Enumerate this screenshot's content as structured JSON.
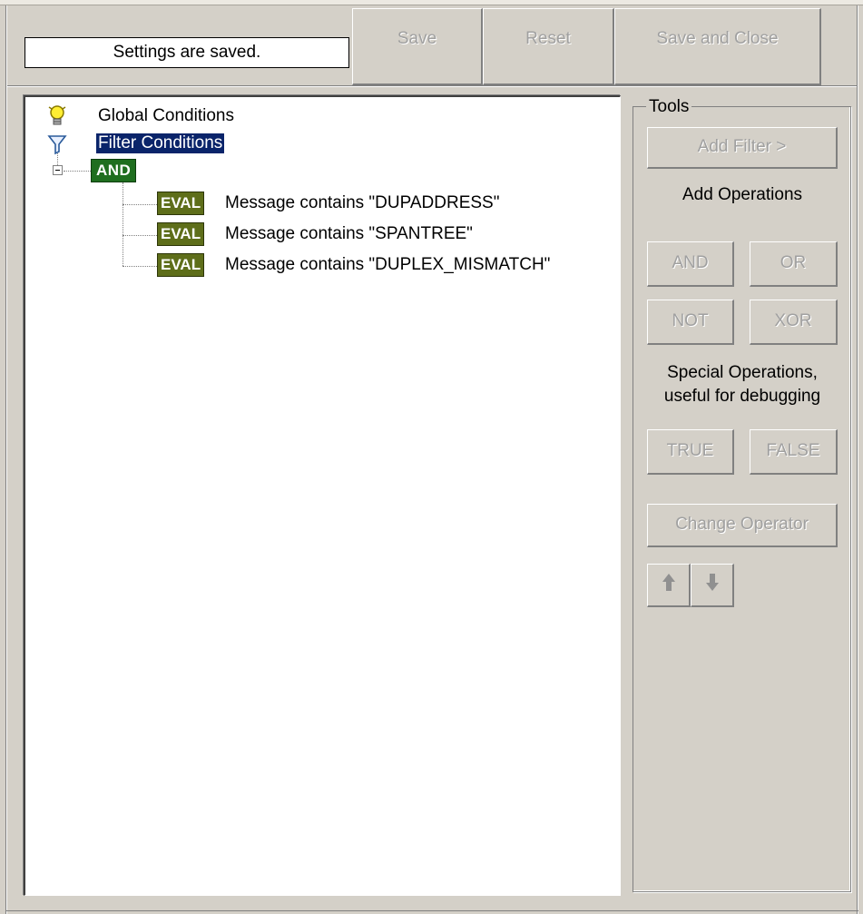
{
  "status": {
    "text": "Settings are saved."
  },
  "toolbar": {
    "save_label": "Save",
    "reset_label": "Reset",
    "save_close_label": "Save and Close"
  },
  "tree": {
    "global_conditions": "Global Conditions",
    "filter_conditions": "Filter Conditions",
    "and_operator": "AND",
    "eval_badge": "EVAL",
    "items": [
      {
        "badge": "EVAL",
        "text": "Message contains \"DUPADDRESS\""
      },
      {
        "badge": "EVAL",
        "text": "Message contains \"SPANTREE\""
      },
      {
        "badge": "EVAL",
        "text": "Message contains \"DUPLEX_MISMATCH\""
      }
    ]
  },
  "tools": {
    "title": "Tools",
    "add_filter": "Add Filter >",
    "add_operations": "Add Operations",
    "and": "AND",
    "or": "OR",
    "not": "NOT",
    "xor": "XOR",
    "special_line1": "Special Operations,",
    "special_line2": "useful for debugging",
    "true": "TRUE",
    "false": "FALSE",
    "change_operator": "Change Operator"
  },
  "icons": {
    "global": "lightbulb-icon",
    "filter": "funnel-icon",
    "move_up": "arrow-up-icon",
    "move_down": "arrow-down-icon"
  }
}
